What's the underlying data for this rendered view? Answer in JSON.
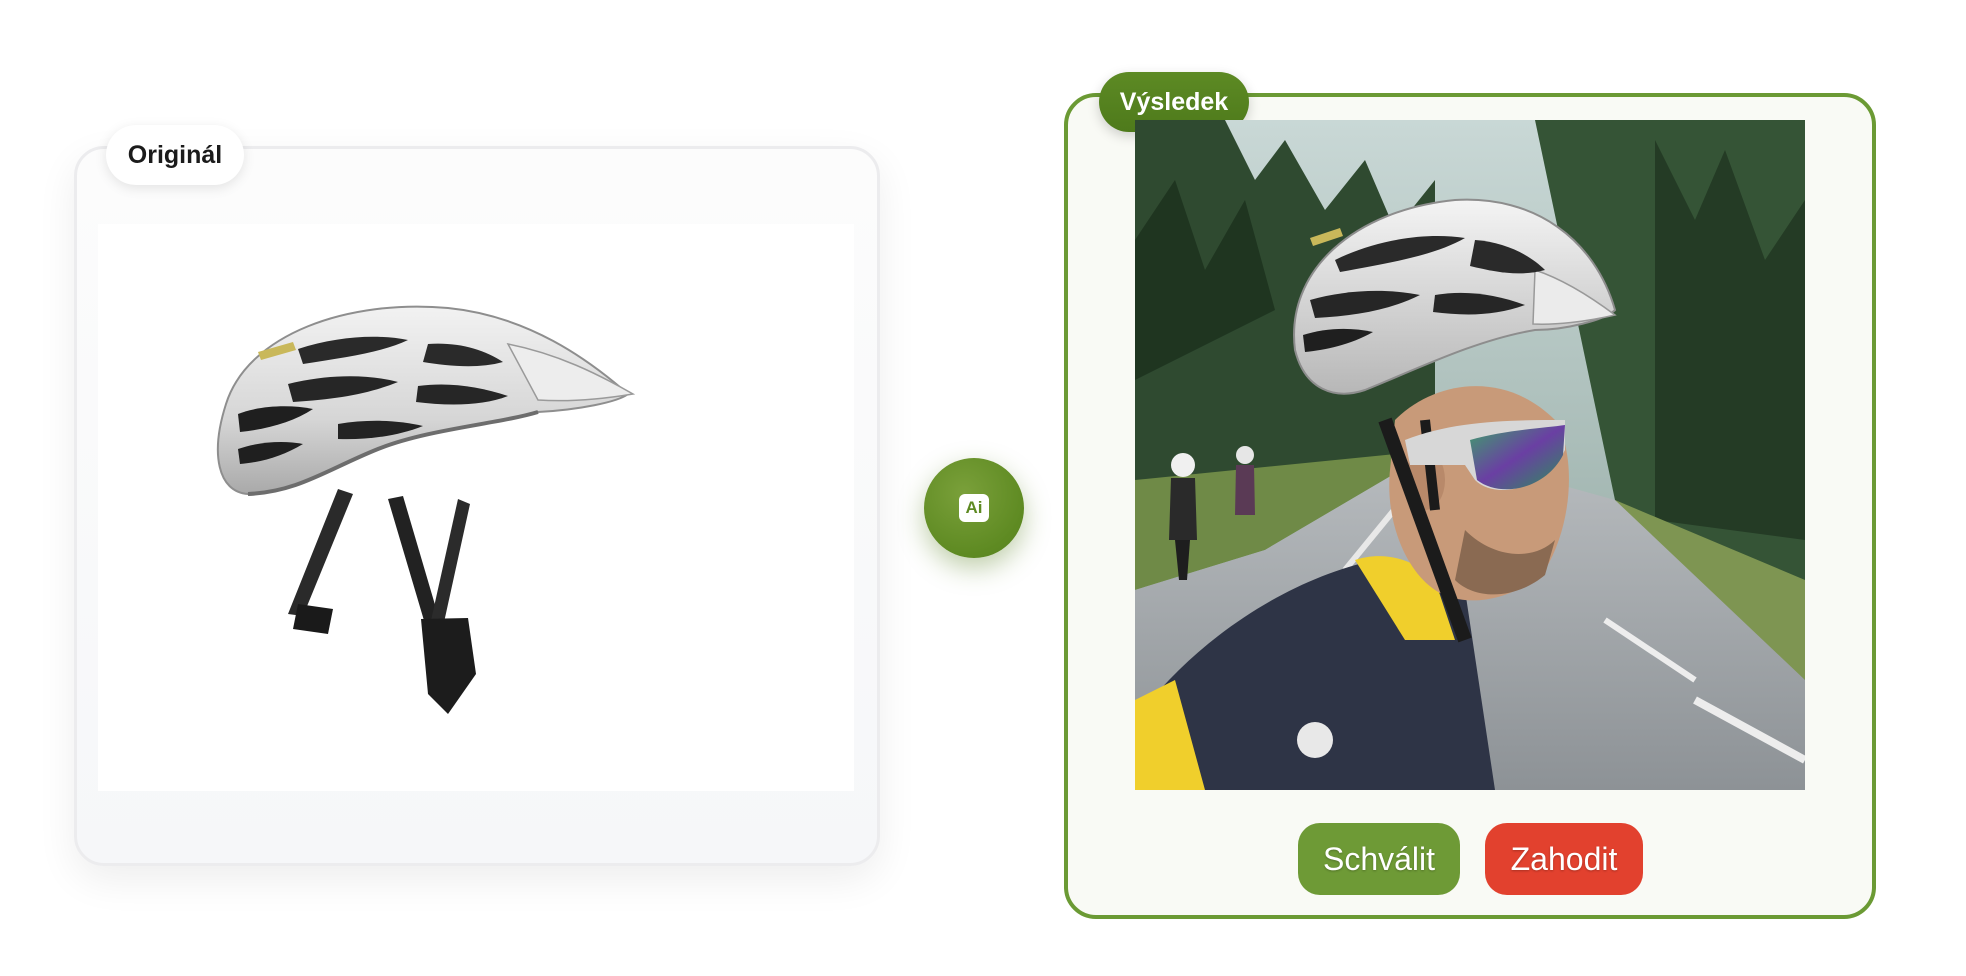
{
  "original": {
    "label": "Originál",
    "image": "helmet-product-photo"
  },
  "ai_badge": {
    "text": "Ai"
  },
  "result": {
    "label": "Výsledek",
    "image": "cyclist-wearing-helmet-photo"
  },
  "actions": {
    "approve_label": "Schválit",
    "discard_label": "Zahodit"
  },
  "colors": {
    "accent_green": "#6b9a34",
    "label_green": "#567f1f",
    "discard_red": "#e2412e",
    "card_border": "#ececee"
  }
}
